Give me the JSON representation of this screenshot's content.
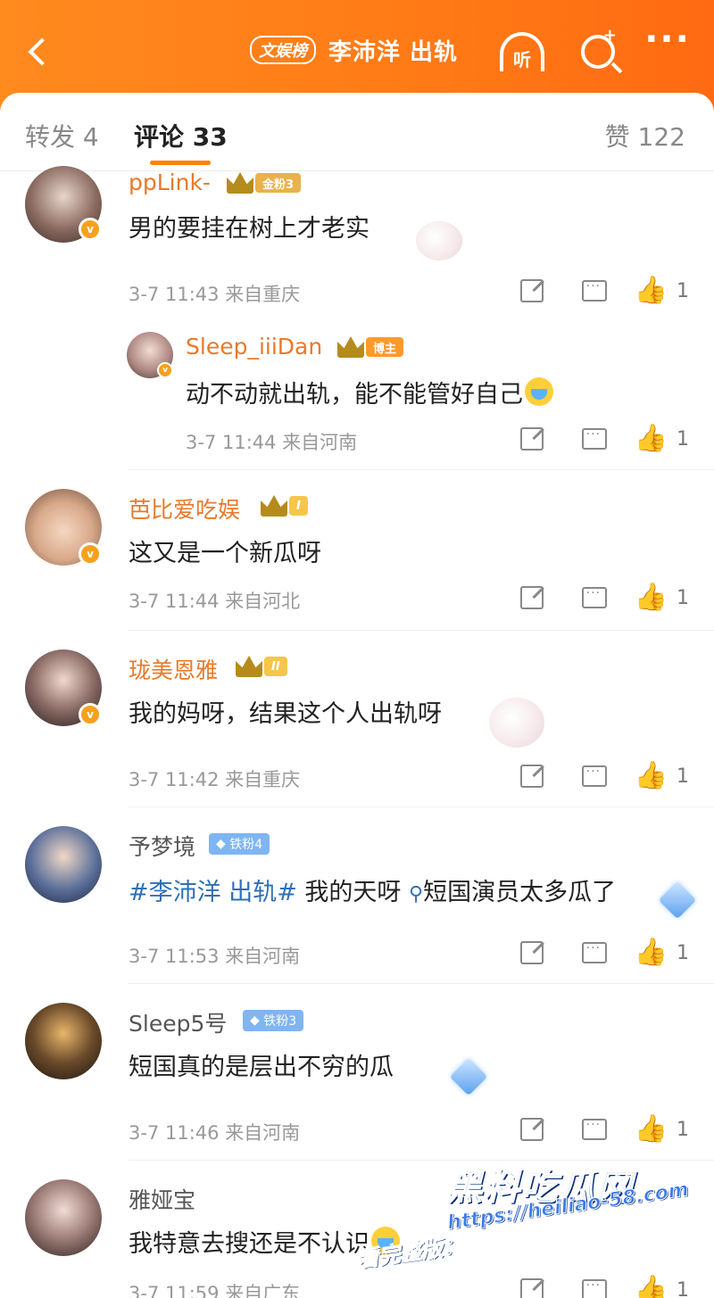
{
  "header": {
    "back_icon": "chevron-left-icon",
    "badge": "文娱榜",
    "title": "李沛洋 出轨",
    "listen_label": "听",
    "search_icon": "search-icon",
    "more_icon": "more-dots-icon"
  },
  "tabs": {
    "repost": "转发 4",
    "comment": "评论 33",
    "like": "赞 122"
  },
  "comments": [
    {
      "user": "ppLink-",
      "tag": "金粉3",
      "text": "男的要挂在树上才老实",
      "time": "3-7 11:43",
      "location": "来自重庆",
      "likes": "1",
      "reply": {
        "user": "Sleep_iiiDan",
        "tag": "博主",
        "text": "动不动就出轨，能不能管好自己",
        "time": "3-7 11:44",
        "location": "来自河南",
        "likes": "1"
      }
    },
    {
      "user": "芭比爱吃娱",
      "tag": "I",
      "text": "这又是一个新瓜呀",
      "time": "3-7 11:44",
      "location": "来自河北",
      "likes": "1"
    },
    {
      "user": "珑美恩雅",
      "tag": "II",
      "text": "我的妈呀，结果这个人出轨呀",
      "time": "3-7 11:42",
      "location": "来自重庆",
      "likes": "1"
    },
    {
      "user": "予梦境",
      "tag": "铁粉4",
      "hashtag": "#李沛洋 出轨#",
      "text": " 我的天呀 ",
      "search_text": "短国演员太多瓜了",
      "time": "3-7 11:53",
      "location": "来自河南",
      "likes": "1"
    },
    {
      "user": "Sleep5号",
      "tag": "铁粉3",
      "text": "短国真的是层出不穷的瓜",
      "time": "3-7 11:46",
      "location": "来自河南",
      "likes": "1"
    },
    {
      "user": "雅娅宝",
      "text": "我特意去搜还是不认识",
      "time": "3-7 11:59",
      "location": "来自广东",
      "likes": "1"
    }
  ],
  "watermark": {
    "title": "黑料吃瓜网",
    "url": "https://heiliao-58.com",
    "prefix": "看完整版："
  },
  "colors": {
    "header_orange": "#ff7a16",
    "username_orange": "#e8792a",
    "hashtag_blue": "#2f6fb8",
    "tab_indicator": "#ff8200"
  }
}
